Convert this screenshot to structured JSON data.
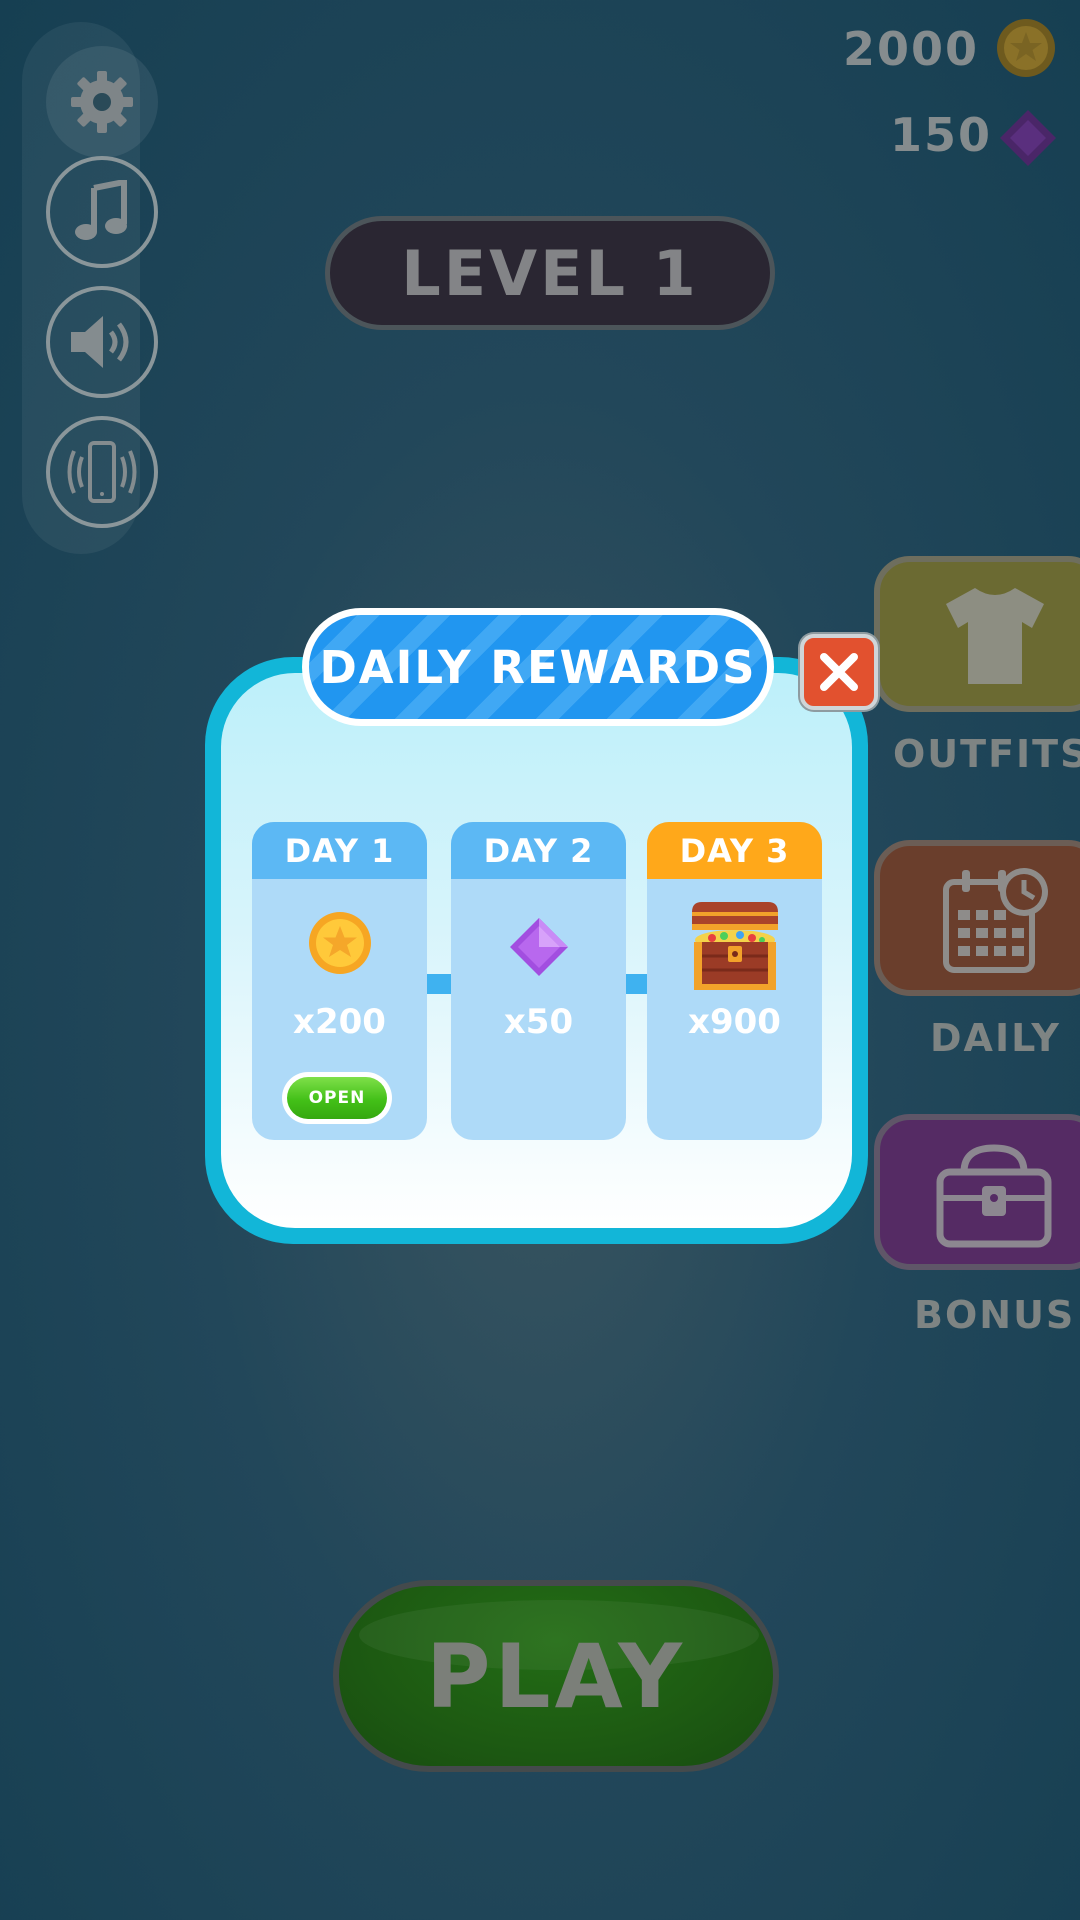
{
  "currency": {
    "coins": "2000",
    "gems": "150"
  },
  "level": {
    "label": "LEVEL 1"
  },
  "side_menu": {
    "outfits_label": "OUTFITS",
    "daily_label": "DAILY",
    "bonus_label": "BONUS"
  },
  "daily_rewards": {
    "title": "DAILY REWARDS",
    "days": [
      {
        "label": "DAY 1",
        "amount": "x200",
        "reward": "coin-icon"
      },
      {
        "label": "DAY 2",
        "amount": "x50",
        "reward": "gem-icon"
      },
      {
        "label": "DAY 3",
        "amount": "x900",
        "reward": "treasure-chest-icon"
      }
    ],
    "open_label": "OPEN"
  },
  "play": {
    "label": "PLAY"
  },
  "colors": {
    "modal_border": "#12b6d8",
    "title_blue": "#2196f0",
    "day_header": "#5cb8f4",
    "day_header_active": "#ffa81a",
    "open_green": "#43c018",
    "close_red": "#e2512f"
  }
}
